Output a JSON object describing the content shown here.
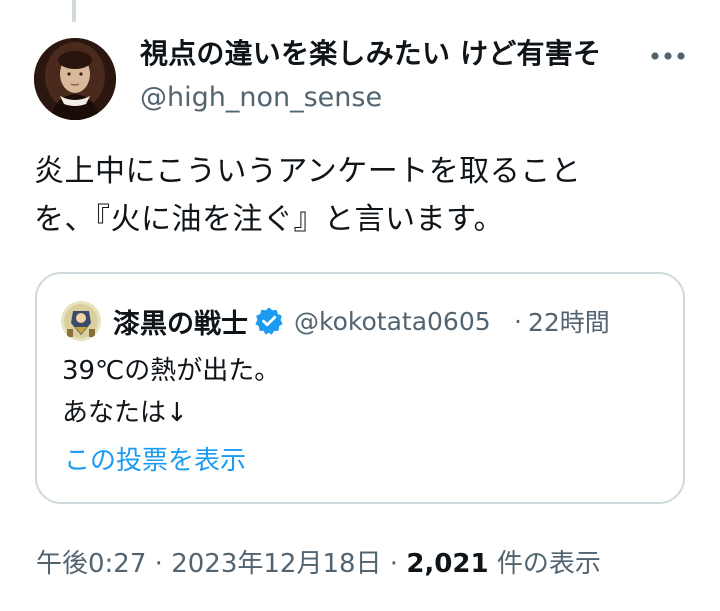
{
  "tweet": {
    "author": {
      "display_name": "視点の違いを楽しみたい けど有害そ",
      "handle": "@high_non_sense"
    },
    "text_lines": [
      "炎上中にこういうアンケートを取ること",
      "を、『火に油を注ぐ』と言います。"
    ],
    "quote": {
      "display_name": "漆黒の戦士",
      "handle": "@kokotata0605",
      "separator": "·",
      "time": "22時間",
      "text_lines": [
        "39℃の熱が出た。",
        "あなたは↓"
      ],
      "poll_link": "この投票を表示"
    },
    "meta": {
      "time": "午後0:27",
      "sep1": "·",
      "date": "2023年12月18日",
      "sep2": "·",
      "views_count": "2,021",
      "views_label": "件の表示"
    }
  },
  "colors": {
    "text_primary": "#0f1419",
    "text_secondary": "#536471",
    "link": "#1d9bf0",
    "verified": "#1d9bf0",
    "border": "#cfd9de"
  },
  "icons": {
    "more": "more-horizontal-icon",
    "verified": "verified-badge-icon"
  }
}
